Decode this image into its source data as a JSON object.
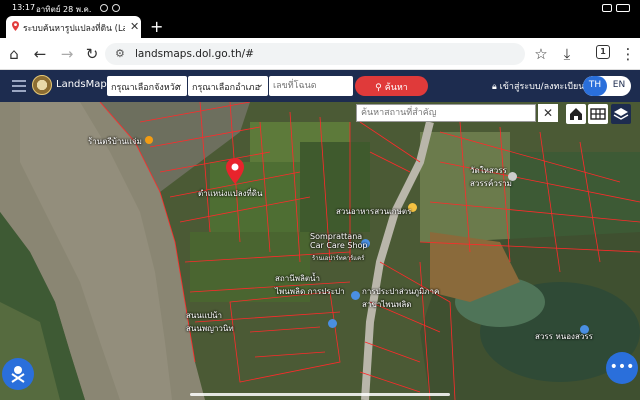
{
  "status_bar": {
    "time": "13:17",
    "date": "อาทิตย์ 28 พ.ค.",
    "right": ""
  },
  "browser": {
    "tab_title": "ระบบค้นหารูปแปลงที่ดิน (Lan",
    "url": "landsmaps.dol.go.th/#",
    "tab_count": "1"
  },
  "header": {
    "app_name": "LandsMaps",
    "province_placeholder": "กรุณาเลือกจังหวัด",
    "district_placeholder": "กรุณาเลือกอำเภอ",
    "parcel_placeholder": "เลขที่โฉนด",
    "search_label": "ค้นหา",
    "login_label": "เข้าสู่ระบบ/ลงทะเบียน",
    "lang_th": "TH",
    "lang_en": "EN"
  },
  "map": {
    "place_search_placeholder": "ค้นหาสถานที่สำคัญ",
    "labels": {
      "shop_top": "ร้านตรีบ้านแจ่ม",
      "pin_label": "ตำแหน่งแปลงที่ดิน",
      "temple": "วัดใหสวรร\nสวรรค์วราม",
      "garden_food": "สวนอาหารสวนเกษตร",
      "car_care": "Somprattana\nCar Care Shop",
      "car_care_th": "ร้านเอปาร์ทคาร์แคร์",
      "pump": "สถานีพลิตน้ำ\nไพนพลิด การประปา",
      "waterworks": "การประปาส่วนภูมิภาค\nสาขาไพนพลิด",
      "lower_place": "สนนแปน้า\nสนนพญาวนิท",
      "river_label": "สวรร หนองสวรร"
    }
  },
  "colors": {
    "header_bg": "#1d2c4f",
    "accent_blue": "#2a6fdb",
    "search_red": "#e03a3a",
    "parcel_line": "#ff2a2a"
  },
  "icons": [
    "location-pin-icon",
    "search-icon",
    "close-icon",
    "home-icon",
    "grid-icon",
    "layers-icon",
    "more-icon",
    "lock-icon"
  ]
}
